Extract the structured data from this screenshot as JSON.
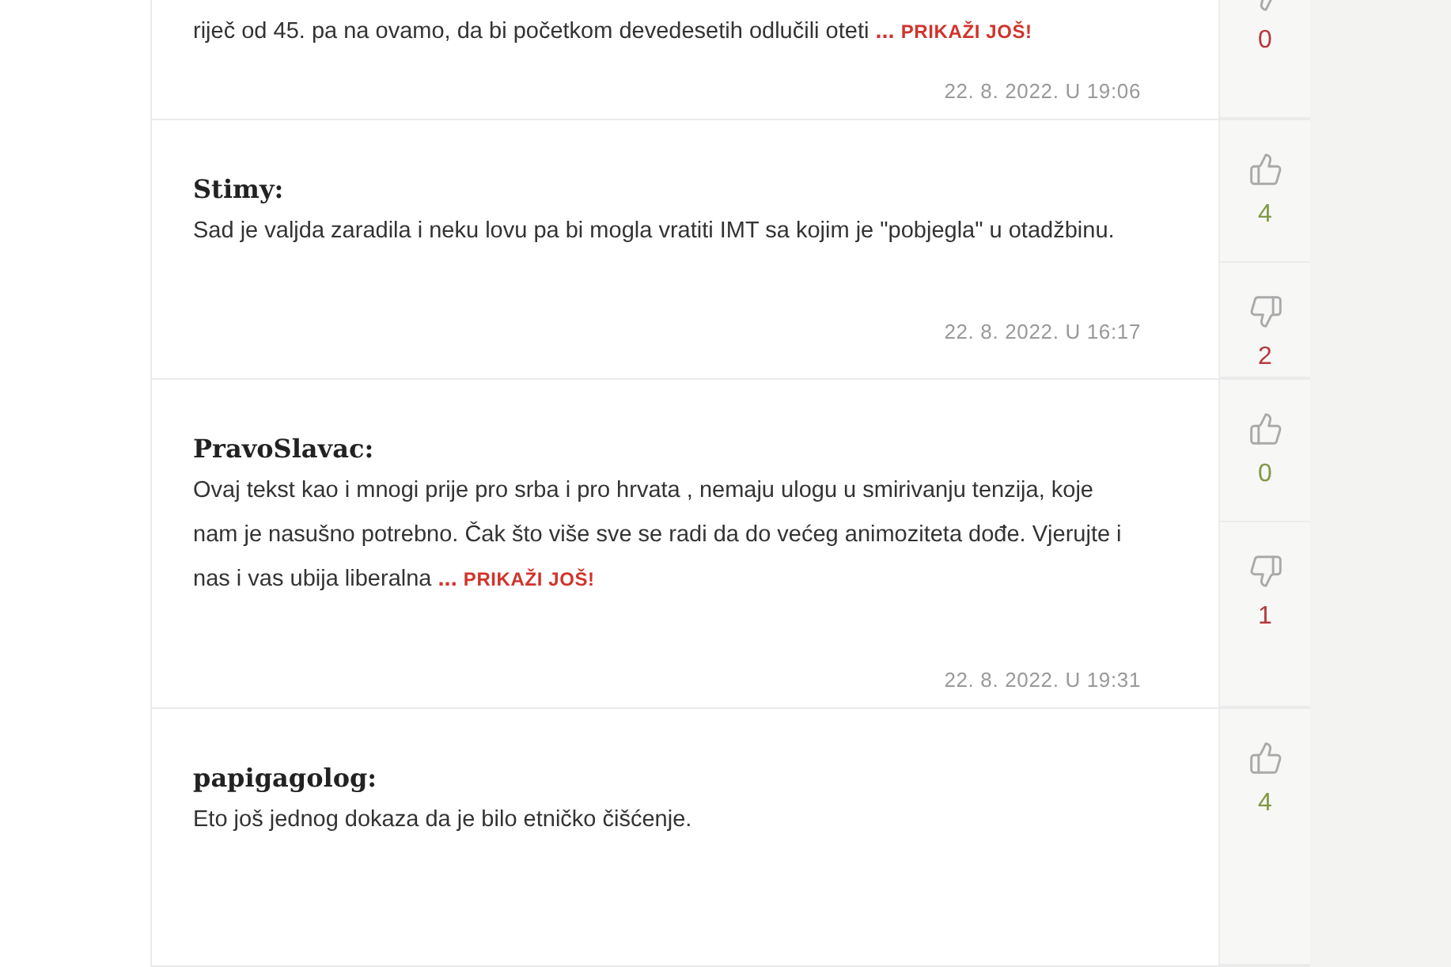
{
  "comments": [
    {
      "text": "riječ od 45. pa na ovamo, da bi početkom devedesetih odlučili oteti",
      "ellipsis": "...",
      "more_link": "PRIKAŽI JOŠ!",
      "date": "22. 8. 2022. U 19:06",
      "votes": [
        {
          "kind": "dislike",
          "count": "0"
        }
      ]
    },
    {
      "author": "Stimy:",
      "text": "Sad je valjda zaradila i neku lovu pa bi mogla vratiti IMT sa kojim je \"pobjegla\" u otadžbinu.",
      "date": "22. 8. 2022. U 16:17",
      "votes": [
        {
          "kind": "like",
          "count": "4"
        },
        {
          "kind": "dislike",
          "count": "2"
        }
      ]
    },
    {
      "author": "PravoSlavac:",
      "text": "Ovaj tekst kao i mnogi prije pro srba i pro hrvata , nemaju ulogu u smirivanju tenzija, koje nam je nasušno potrebno. Čak što više sve se radi da do većeg animoziteta dođe. Vjerujte i nas i vas ubija liberalna",
      "ellipsis": "...",
      "more_link": "PRIKAŽI JOŠ!",
      "date": "22. 8. 2022. U 19:31",
      "votes": [
        {
          "kind": "like",
          "count": "0"
        },
        {
          "kind": "dislike",
          "count": "1"
        }
      ]
    },
    {
      "author": "papigagolog:",
      "text": "Eto još jednog dokaza da je bilo etničko čišćenje.",
      "votes": [
        {
          "kind": "like",
          "count": "4"
        }
      ]
    }
  ]
}
